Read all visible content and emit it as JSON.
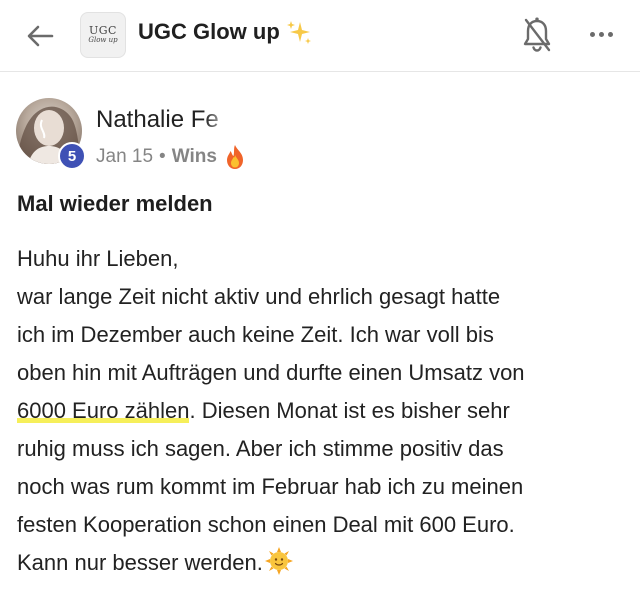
{
  "header": {
    "group_name": "UGC Glow up",
    "logo_text": "UGC",
    "logo_subtext": "Glow up",
    "icons": [
      "back-arrow-icon",
      "bell-off-icon",
      "more-icon"
    ],
    "sparkle_emoji": "sparkles"
  },
  "post": {
    "author": {
      "name": "Nathalie Fe",
      "level": "5"
    },
    "date": "Jan 15",
    "separator": "•",
    "category": "Wins",
    "category_emoji": "fire",
    "title": "Mal wieder melden",
    "body_lines": [
      "Huhu ihr Lieben,",
      "war lange Zeit nicht aktiv und ehrlich gesagt hatte",
      "ich im Dezember auch keine Zeit. Ich war voll bis",
      "oben hin mit Aufträgen und durfte einen Umsatz von"
    ],
    "highlight": "6000 Euro zählen",
    "line5_rest": ". Diesen Monat ist es bisher sehr",
    "body_lines_after": [
      "ruhig muss ich sagen. Aber ich stimme positiv das",
      "noch was rum kommt im Februar hab ich zu meinen",
      "festen Kooperation schon einen Deal mit 600 Euro."
    ],
    "last_line": "Kann nur besser werden.",
    "end_emoji": "sun-face"
  },
  "colors": {
    "level_badge": "#3f51b5",
    "highlight": "#f6ef5a",
    "meta_text": "#858585"
  }
}
